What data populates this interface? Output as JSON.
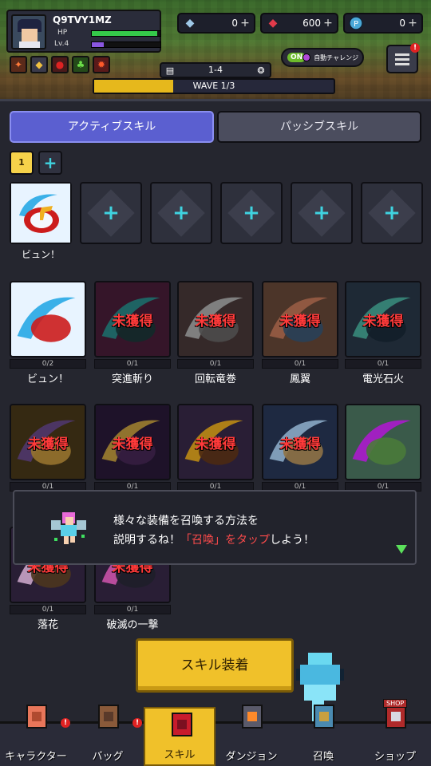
{
  "player": {
    "name": "Q9TVY1MZ",
    "hp_label": "HP",
    "level": "Lv.4",
    "hp_fraction": 0.95,
    "exp_fraction": 0.18
  },
  "currency": [
    {
      "icon": "diamond-icon",
      "value": "0"
    },
    {
      "icon": "ruby-icon",
      "value": "600"
    },
    {
      "icon": "coin-icon",
      "value": "0"
    }
  ],
  "stage": {
    "label": "1-4",
    "wave": "WAVE 1/3",
    "wave_progress": 0.33
  },
  "auto": {
    "toggle": "ON",
    "label": "自動チャレンジ"
  },
  "menu": {
    "badge": "!"
  },
  "tabs": {
    "active": "アクティブスキル",
    "passive": "パッシブスキル"
  },
  "presets": {
    "current": "1",
    "add": "+"
  },
  "equipped": [
    {
      "name": "ビュン！",
      "filled": true
    },
    {
      "filled": false
    },
    {
      "filled": false
    },
    {
      "filled": false
    },
    {
      "filled": false
    },
    {
      "filled": false
    }
  ],
  "locked_text": "未獲得",
  "skills": [
    {
      "name": "ビュン！",
      "count": "0/2",
      "locked": false
    },
    {
      "name": "突進斬り",
      "count": "0/1",
      "locked": true
    },
    {
      "name": "回転竜巻",
      "count": "0/1",
      "locked": true
    },
    {
      "name": "鳳翼",
      "count": "0/1",
      "locked": true
    },
    {
      "name": "電光石火",
      "count": "0/1",
      "locked": true
    },
    {
      "name": "",
      "count": "0/1",
      "locked": true
    },
    {
      "name": "",
      "count": "0/1",
      "locked": true
    },
    {
      "name": "",
      "count": "0/1",
      "locked": true
    },
    {
      "name": "",
      "count": "0/1",
      "locked": true
    },
    {
      "name": "",
      "count": "0/1",
      "locked": false
    },
    {
      "name": "落花",
      "count": "0/1",
      "locked": true
    },
    {
      "name": "破滅の一撃",
      "count": "0/1",
      "locked": true
    }
  ],
  "equip_button": "スキル装着",
  "tutorial": {
    "line1": "様々な装備を召喚する方法を",
    "line2_pre": "説明するね！",
    "line2_hl": "「召喚」をタップ",
    "line2_post": "しよう！"
  },
  "nav": [
    {
      "label": "キャラクター",
      "badge": "!"
    },
    {
      "label": "バッグ",
      "badge": "!"
    },
    {
      "label": "スキル",
      "badge": ""
    },
    {
      "label": "ダンジョン",
      "badge": ""
    },
    {
      "label": "召喚",
      "badge": ""
    },
    {
      "label": "ショップ",
      "badge": ""
    }
  ],
  "shop_sign": "SHOP"
}
